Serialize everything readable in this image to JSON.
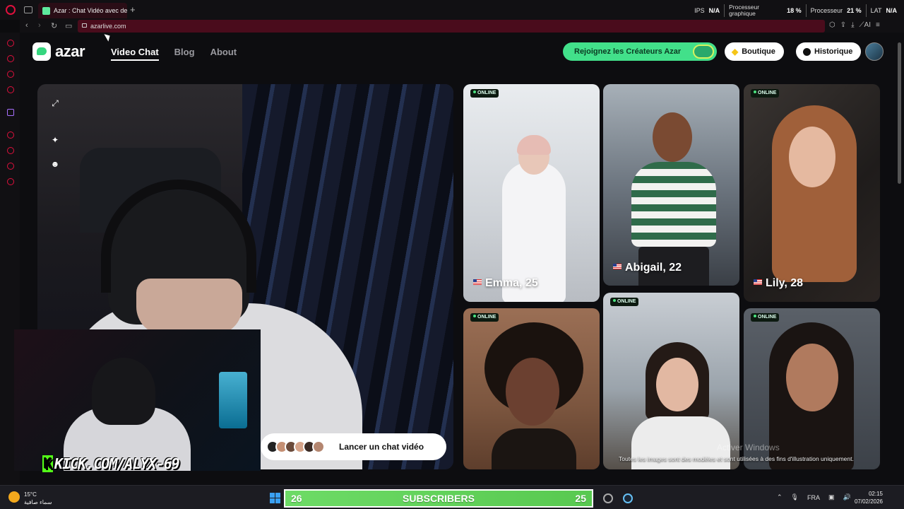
{
  "browser": {
    "tab_title": "Azar : Chat Vidéo avec de",
    "new_tab": "+",
    "url": "azarlive.com",
    "stats": {
      "ips_label": "IPS",
      "ips_value": "N/A",
      "gpu_label": "Processeur graphique",
      "gpu_value": "18 %",
      "cpu_label": "Processeur",
      "cpu_value": "21 %",
      "lat_label": "LAT",
      "lat_value": "N/A"
    },
    "ai_label": "AI"
  },
  "site": {
    "logo_text": "azar",
    "nav": [
      "Video Chat",
      "Blog",
      "About"
    ],
    "creators_button": "Rejoignez les Créateurs Azar",
    "shop_button": "Boutique",
    "history_button": "Historique",
    "launch_button": "Lancer un chat vidéo",
    "cards": [
      {
        "badge": "ONLINE",
        "name": "Emma, 25"
      },
      {
        "badge": "",
        "name": "Abigail, 22"
      },
      {
        "badge": "ONLINE",
        "name": "Lily, 28"
      },
      {
        "badge": "ONLINE",
        "name": ""
      },
      {
        "badge": "ONLINE",
        "name": ""
      },
      {
        "badge": "ONLINE",
        "name": ""
      }
    ],
    "disclaimer": "Toutes les images sont des modèles et sont utilisées à des fins d'illustration uniquement.",
    "watermark": "Activer Windows"
  },
  "stream": {
    "kick_url": "KICK.COM/ALYX-69",
    "kick_k": "K",
    "subs_left": "26",
    "subs_label": "SUBSCRIBERS",
    "subs_right": "25"
  },
  "taskbar": {
    "temp": "15°C",
    "weather": "سماء صافية",
    "lang": "FRA",
    "time": "02:15",
    "date": "07/02/2026"
  },
  "colors": {
    "accent_green": "#42e08a",
    "browser_accent": "#e0103d",
    "subs_green": "#6ddb66"
  }
}
